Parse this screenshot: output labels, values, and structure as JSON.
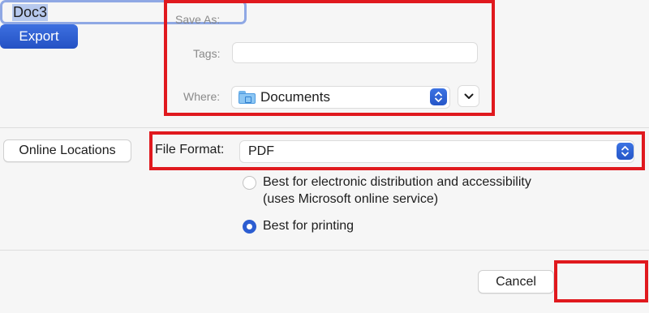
{
  "save_as": {
    "label": "Save As:",
    "value": "Doc3"
  },
  "tags": {
    "label": "Tags:",
    "value": ""
  },
  "where": {
    "label": "Where:",
    "value": "Documents",
    "icon": "folder-icon"
  },
  "online_locations": {
    "label": "Online Locations"
  },
  "file_format": {
    "label": "File Format:",
    "value": "PDF"
  },
  "options": [
    {
      "line1": "Best for electronic distribution and accessibility",
      "line2": "(uses Microsoft online service)",
      "selected": false
    },
    {
      "line1": "Best for printing",
      "selected": true
    }
  ],
  "buttons": {
    "cancel": "Cancel",
    "export": "Export"
  },
  "colors": {
    "accent": "#2c5dd1",
    "highlight": "#e0191e"
  }
}
